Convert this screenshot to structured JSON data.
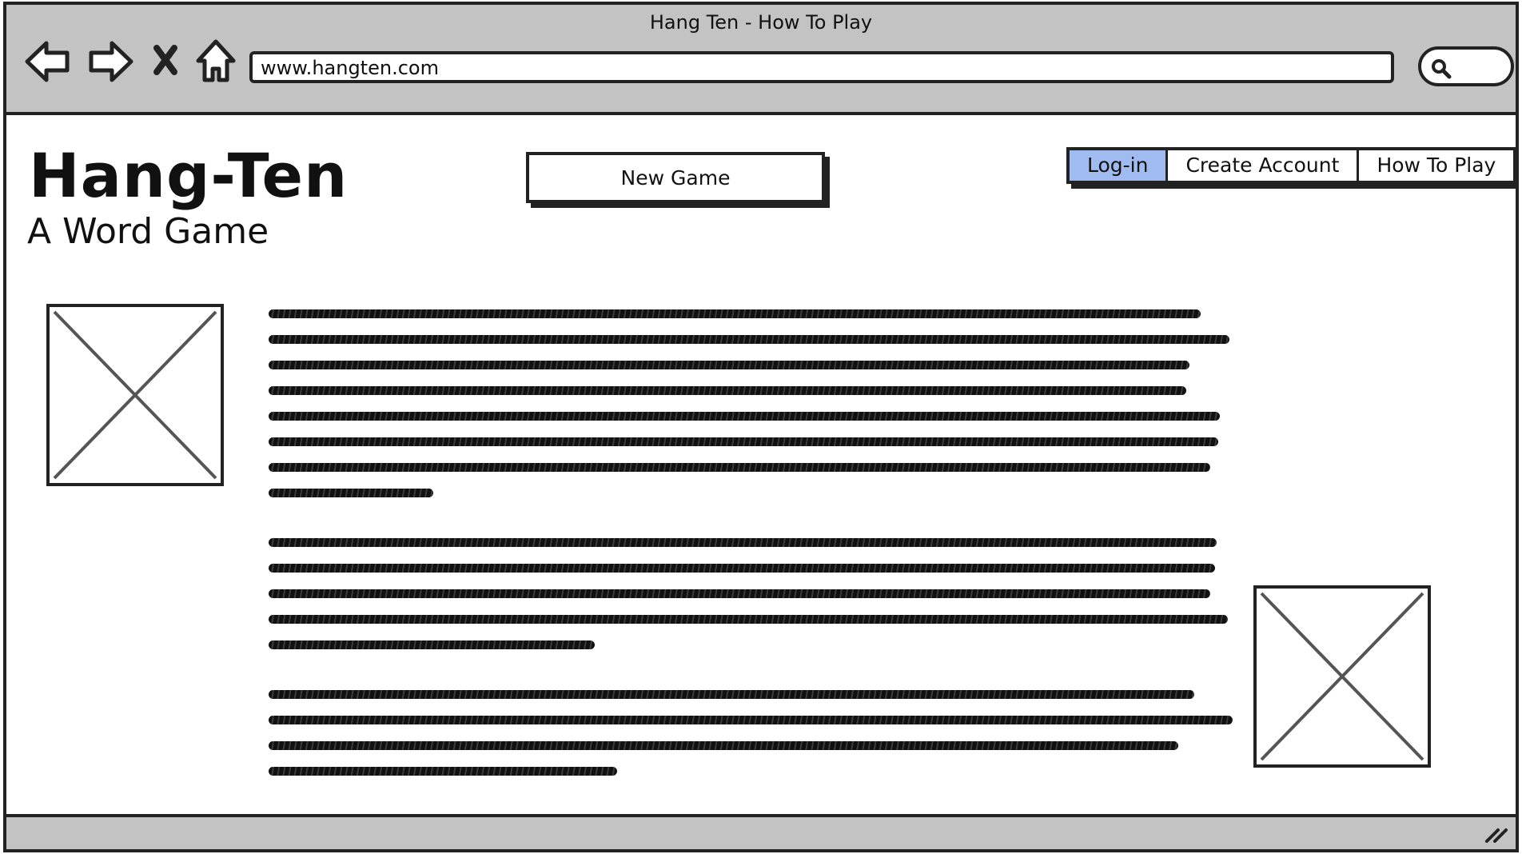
{
  "window": {
    "title": "Hang Ten - How To Play"
  },
  "nav_icons": [
    "back-arrow-icon",
    "forward-arrow-icon",
    "close-icon",
    "home-icon"
  ],
  "address_bar": {
    "url": "www.hangten.com"
  },
  "header": {
    "title": "Hang-Ten",
    "subtitle": "A Word Game"
  },
  "actions": {
    "new_game_label": "New Game"
  },
  "topnav": {
    "items": [
      {
        "label": "Log-in",
        "active": true
      },
      {
        "label": "Create Account",
        "active": false
      },
      {
        "label": "How To Play",
        "active": false
      }
    ]
  },
  "colors": {
    "chrome": "#c3c3c3",
    "active_tab": "#9fbbef",
    "ink": "#222222"
  },
  "content": {
    "images": [
      "image-placeholder-icon",
      "image-placeholder-icon"
    ],
    "paragraph_line_counts": [
      8,
      5,
      4
    ]
  }
}
